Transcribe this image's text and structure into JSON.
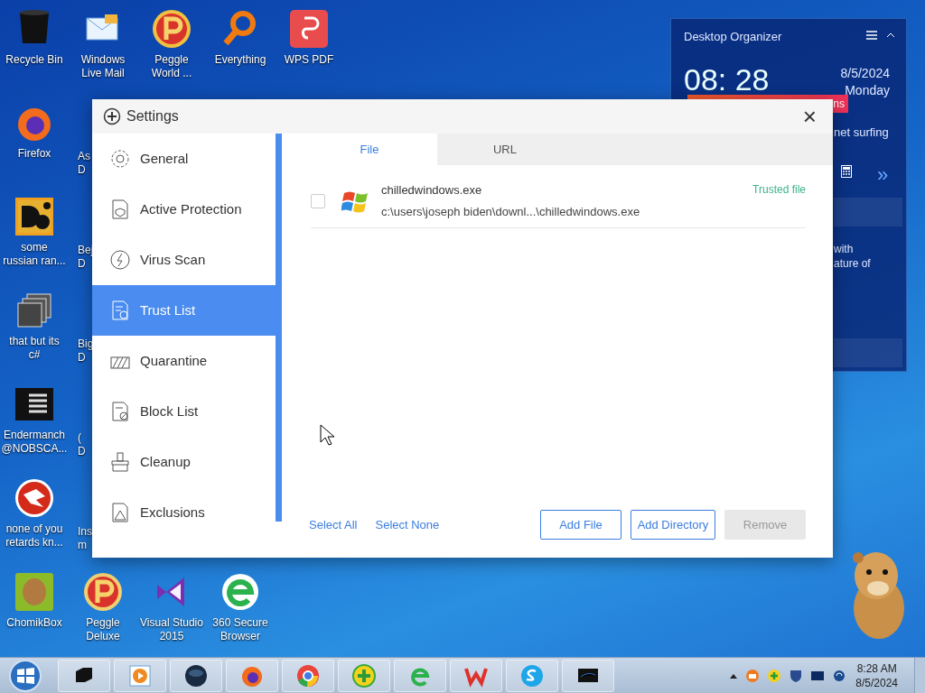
{
  "desktop": {
    "icons": [
      {
        "label": "Recycle Bin"
      },
      {
        "label": "Windows\nLive Mail"
      },
      {
        "label": "Peggle\nWorld ..."
      },
      {
        "label": "Everything"
      },
      {
        "label": "WPS PDF"
      },
      {
        "label": "Firefox"
      },
      {
        "label": "some\nrussian ran..."
      },
      {
        "label": "that but its\nc#"
      },
      {
        "label": "Endermanch\n@NOBSCA..."
      },
      {
        "label": "none of you\nretards kn..."
      },
      {
        "label": "ChomikBox"
      },
      {
        "label": "As\nD"
      },
      {
        "label": "Bej\nD"
      },
      {
        "label": "Big\nD"
      },
      {
        "label": "(\nD"
      },
      {
        "label": "Ins\nm"
      },
      {
        "label": "Peggle\nDeluxe"
      },
      {
        "label": "Visual Studio\n2015"
      },
      {
        "label": "360 Secure\nBrowser"
      }
    ]
  },
  "widget": {
    "title": "Desktop Organizer",
    "clock": "08: 28",
    "date": "8/5/2024",
    "weekday": "Monday",
    "banner": "ns",
    "line_1": "net surfing",
    "more": "»",
    "line_2": "with",
    "line_3": "ature of"
  },
  "window": {
    "title": "Settings",
    "close": "×",
    "sidebar": [
      {
        "label": "General",
        "selected": false
      },
      {
        "label": "Active Protection",
        "selected": false
      },
      {
        "label": "Virus Scan",
        "selected": false
      },
      {
        "label": "Trust List",
        "selected": true
      },
      {
        "label": "Quarantine",
        "selected": false
      },
      {
        "label": "Block List",
        "selected": false
      },
      {
        "label": "Cleanup",
        "selected": false
      },
      {
        "label": "Exclusions",
        "selected": false
      }
    ],
    "tabs": [
      {
        "label": "File",
        "selected": true
      },
      {
        "label": "URL",
        "selected": false
      }
    ],
    "files": [
      {
        "name": "chilledwindows.exe",
        "path": "c:\\users\\joseph biden\\downl...\\chilledwindows.exe",
        "status": "Trusted file",
        "checked": false
      }
    ],
    "links": [
      "Select All",
      "Select None"
    ],
    "buttons": [
      {
        "label": "Add File",
        "disabled": false
      },
      {
        "label": "Add Directory",
        "disabled": false
      },
      {
        "label": "Remove",
        "disabled": true
      }
    ]
  },
  "taskbar": {
    "clock": "8:28 AM",
    "date": "8/5/2024"
  }
}
